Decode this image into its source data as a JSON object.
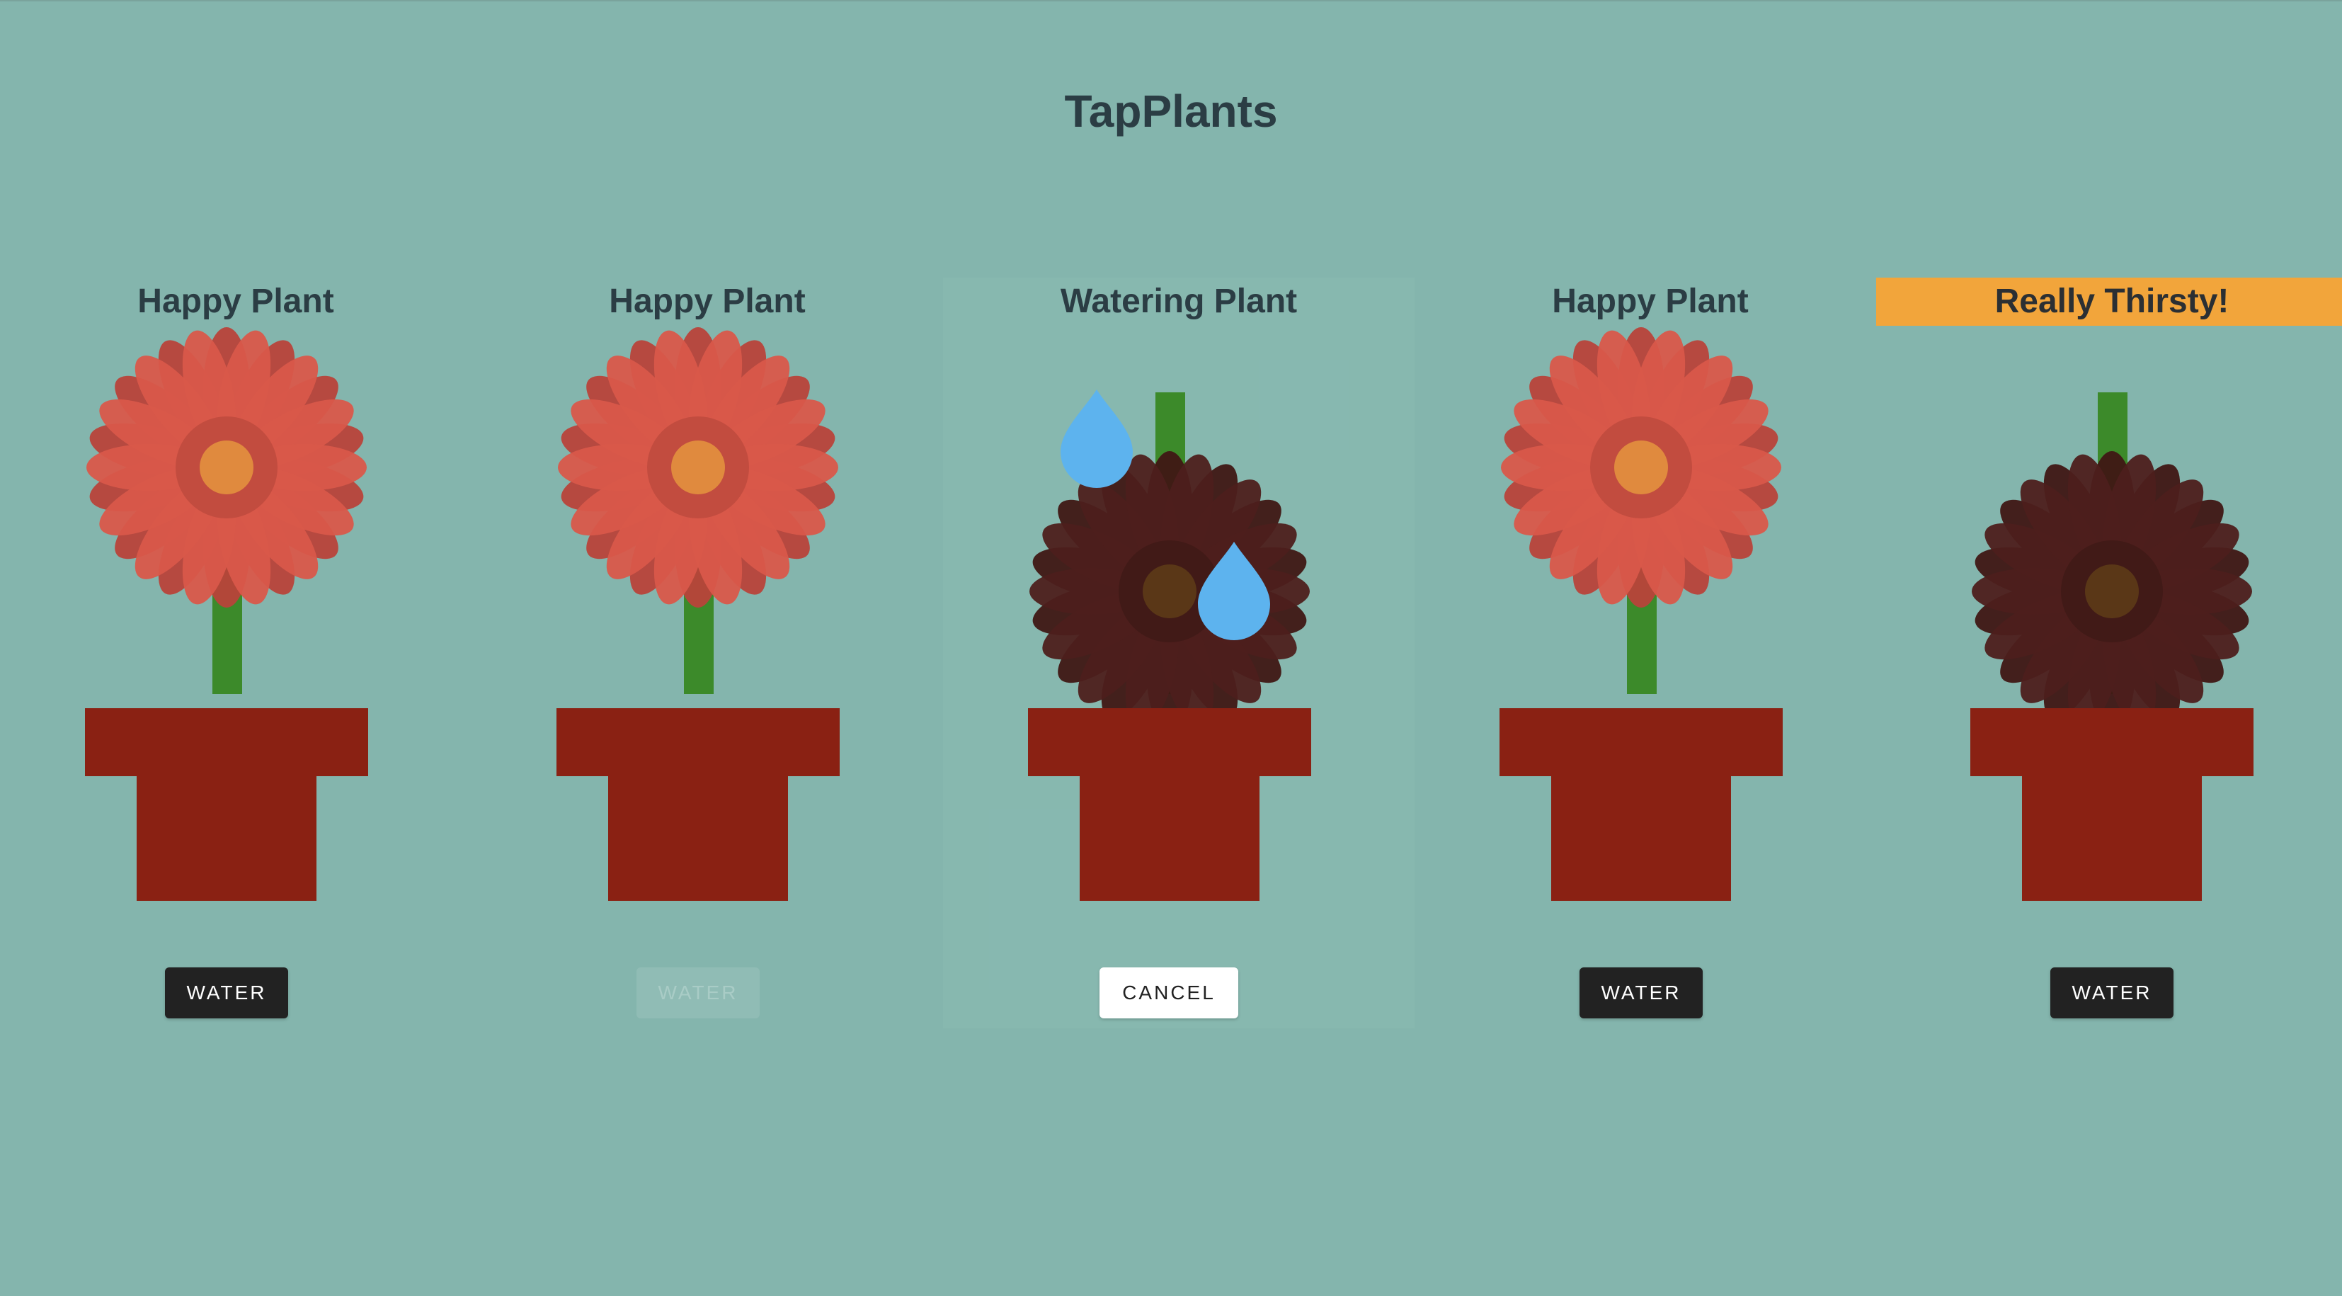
{
  "app": {
    "title": "TapPlants"
  },
  "colors": {
    "background": "#84b5ad",
    "petal_happy": "#d9594a",
    "petal_happy_dark": "#b8433a",
    "center_happy": "#e08a3e",
    "petal_wilted": "#4d1f1c",
    "center_wilted": "#5a3717",
    "stem": "#3c8a2a",
    "pot": "#8a2113",
    "water_drop": "#5db3ee",
    "alert_banner": "#f2a53b",
    "button_dark": "#222222"
  },
  "plants": [
    {
      "status": "Happy Plant",
      "state": "happy",
      "button_label": "WATER",
      "button_state": "enabled"
    },
    {
      "status": "Happy Plant",
      "state": "happy",
      "button_label": "WATER",
      "button_state": "disabled"
    },
    {
      "status": "Watering Plant",
      "state": "watering",
      "button_label": "CANCEL",
      "button_state": "cancel"
    },
    {
      "status": "Happy Plant",
      "state": "happy",
      "button_label": "WATER",
      "button_state": "enabled"
    },
    {
      "status": "Really Thirsty!",
      "state": "thirsty",
      "button_label": "WATER",
      "button_state": "enabled"
    }
  ]
}
